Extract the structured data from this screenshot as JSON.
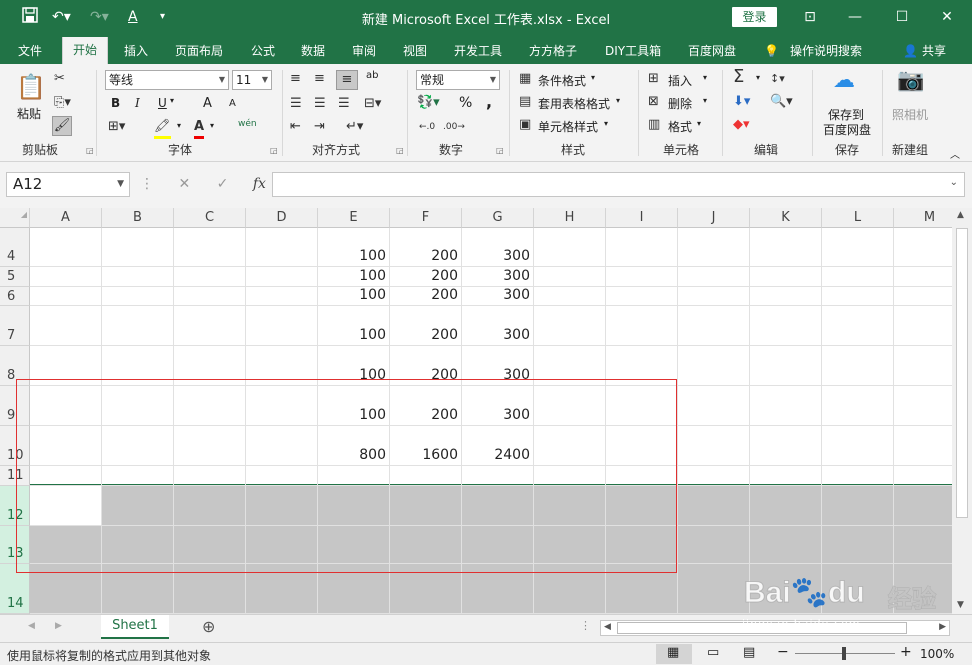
{
  "titlebar": {
    "title": "新建 Microsoft Excel 工作表.xlsx  -  Excel",
    "login_label": "登录",
    "save_icon": "save-icon",
    "undo_icon": "undo-icon",
    "redo_icon": "redo-icon",
    "font_color_icon": "font-color-icon"
  },
  "tabs": [
    "文件",
    "开始",
    "插入",
    "页面布局",
    "公式",
    "数据",
    "审阅",
    "视图",
    "开发工具",
    "方方格子",
    "DIY工具箱",
    "百度网盘",
    "操作说明搜索",
    "共享"
  ],
  "ribbon": {
    "clipboard": {
      "paste": "粘贴",
      "group": "剪贴板"
    },
    "font": {
      "name": "等线",
      "size": "11",
      "group": "字体",
      "bold": "B",
      "italic": "I",
      "underline": "U",
      "grow": "A",
      "shrink": "A",
      "wen": "wén"
    },
    "align": {
      "group": "对齐方式",
      "wrap": "ab"
    },
    "number": {
      "format": "常规",
      "group": "数字",
      "percent": "%",
      "comma": ","
    },
    "styles": {
      "cond": "条件格式",
      "table": "套用表格格式",
      "cell": "单元格样式",
      "group": "样式"
    },
    "cells": {
      "insert": "插入",
      "delete": "删除",
      "format": "格式",
      "group": "单元格"
    },
    "edit": {
      "group": "编辑"
    },
    "save": {
      "line1": "保存到",
      "line2": "百度网盘",
      "group": "保存"
    },
    "camera": {
      "label": "照相机",
      "group": "新建组"
    }
  },
  "formula_bar": {
    "namebox": "A12",
    "fx": "fx",
    "value": ""
  },
  "grid": {
    "columns": [
      "A",
      "B",
      "C",
      "D",
      "E",
      "F",
      "G",
      "H",
      "I",
      "J",
      "K",
      "L",
      "M"
    ],
    "rows": [
      "4",
      "5",
      "6",
      "7",
      "8",
      "9",
      "10",
      "11",
      "12",
      "13",
      "14"
    ],
    "cells": [
      [
        "100",
        "200",
        "300"
      ],
      [
        "100",
        "200",
        "300"
      ],
      [
        "100",
        "200",
        "300"
      ],
      [
        "100",
        "200",
        "300"
      ],
      [
        "100",
        "200",
        "300"
      ],
      [
        "100",
        "200",
        "300"
      ],
      [
        "800",
        "1600",
        "2400"
      ]
    ]
  },
  "sheets": {
    "active": "Sheet1",
    "add": "⊕"
  },
  "status": {
    "message": "使用鼠标将复制的格式应用到其他对象",
    "zoom": "100%"
  },
  "watermark": {
    "brand": "Bai",
    "brand2": "du",
    "cn": "经验",
    "url": "jingyan.baidu.com"
  }
}
